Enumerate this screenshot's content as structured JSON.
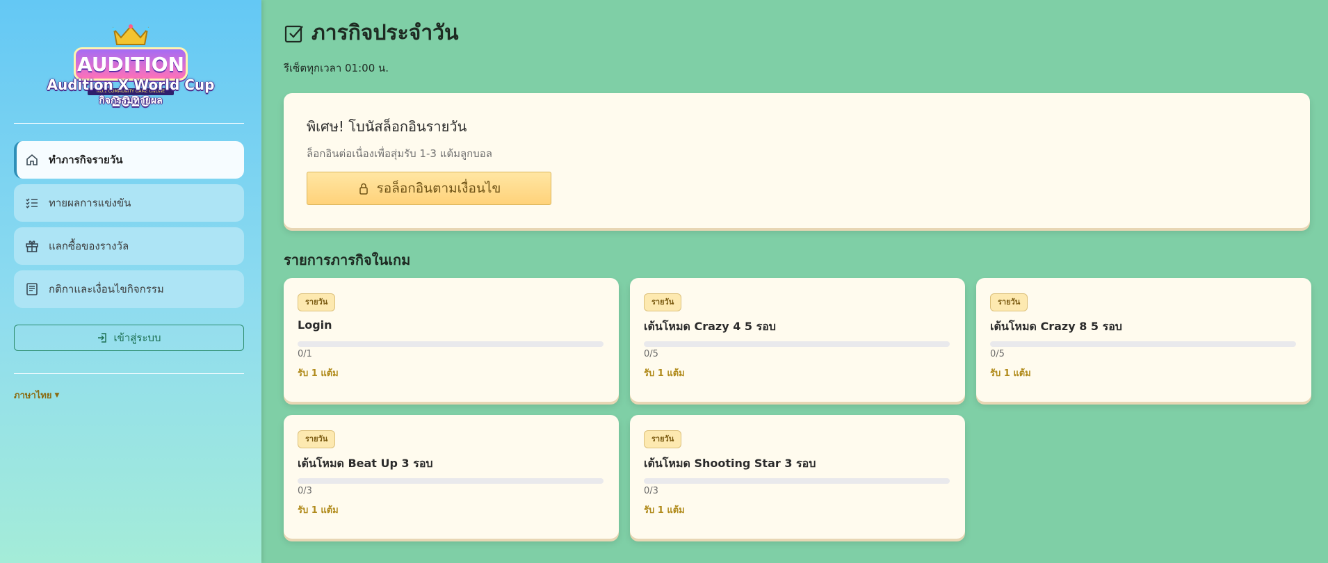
{
  "sidebar": {
    "logo": {
      "wordmark": "AUDITION",
      "tagline": "NO.1 COMMUNITY GAME ONLINE",
      "title": "Audition X World Cup 2026",
      "subtitle": "กิจกรรมทายผล"
    },
    "nav": [
      {
        "label": "ทำภารกิจรายวัน",
        "icon": "home-icon",
        "active": true
      },
      {
        "label": "ทายผลการแข่งขัน",
        "icon": "checklist-icon",
        "active": false
      },
      {
        "label": "แลกซื้อของรางวัล",
        "icon": "gift-icon",
        "active": false
      },
      {
        "label": "กติกาและเงื่อนไขกิจกรรม",
        "icon": "document-icon",
        "active": false
      }
    ],
    "login_label": "เข้าสู่ระบบ",
    "language_label": "ภาษาไทย"
  },
  "main": {
    "title": "ภารกิจประจำวัน",
    "reset_note": "รีเซ็ตทุกเวลา 01:00 น.",
    "bonus": {
      "title": "พิเศษ! โบนัสล็อกอินรายวัน",
      "description": "ล็อกอินต่อเนื่องเพื่อสุ่มรับ 1-3 แต้มลูกบอล",
      "button_label": "รอล็อกอินตามเงื่อนไข"
    },
    "missions_title": "รายการภารกิจในเกม",
    "missions": [
      {
        "badge": "รายวัน",
        "name": "Login",
        "progress": "0/1",
        "completed": 0,
        "target": 1,
        "reward": "รับ 1 แต้ม"
      },
      {
        "badge": "รายวัน",
        "name": "เต้นโหมด Crazy 4 5 รอบ",
        "progress": "0/5",
        "completed": 0,
        "target": 5,
        "reward": "รับ 1 แต้ม"
      },
      {
        "badge": "รายวัน",
        "name": "เต้นโหมด Crazy 8 5 รอบ",
        "progress": "0/5",
        "completed": 0,
        "target": 5,
        "reward": "รับ 1 แต้ม"
      },
      {
        "badge": "รายวัน",
        "name": "เต้นโหมด Beat Up 3 รอบ",
        "progress": "0/3",
        "completed": 0,
        "target": 3,
        "reward": "รับ 1 แต้ม"
      },
      {
        "badge": "รายวัน",
        "name": "เต้นโหมด Shooting Star 3 รอบ",
        "progress": "0/3",
        "completed": 0,
        "target": 3,
        "reward": "รับ 1 แต้ม"
      }
    ]
  },
  "colors": {
    "background": "#7fcfa6",
    "card": "#fffbee",
    "accent_gold": "#b08a1a",
    "sidebar_active_border": "#2e8fb8",
    "login_border": "#2a8a6a"
  }
}
